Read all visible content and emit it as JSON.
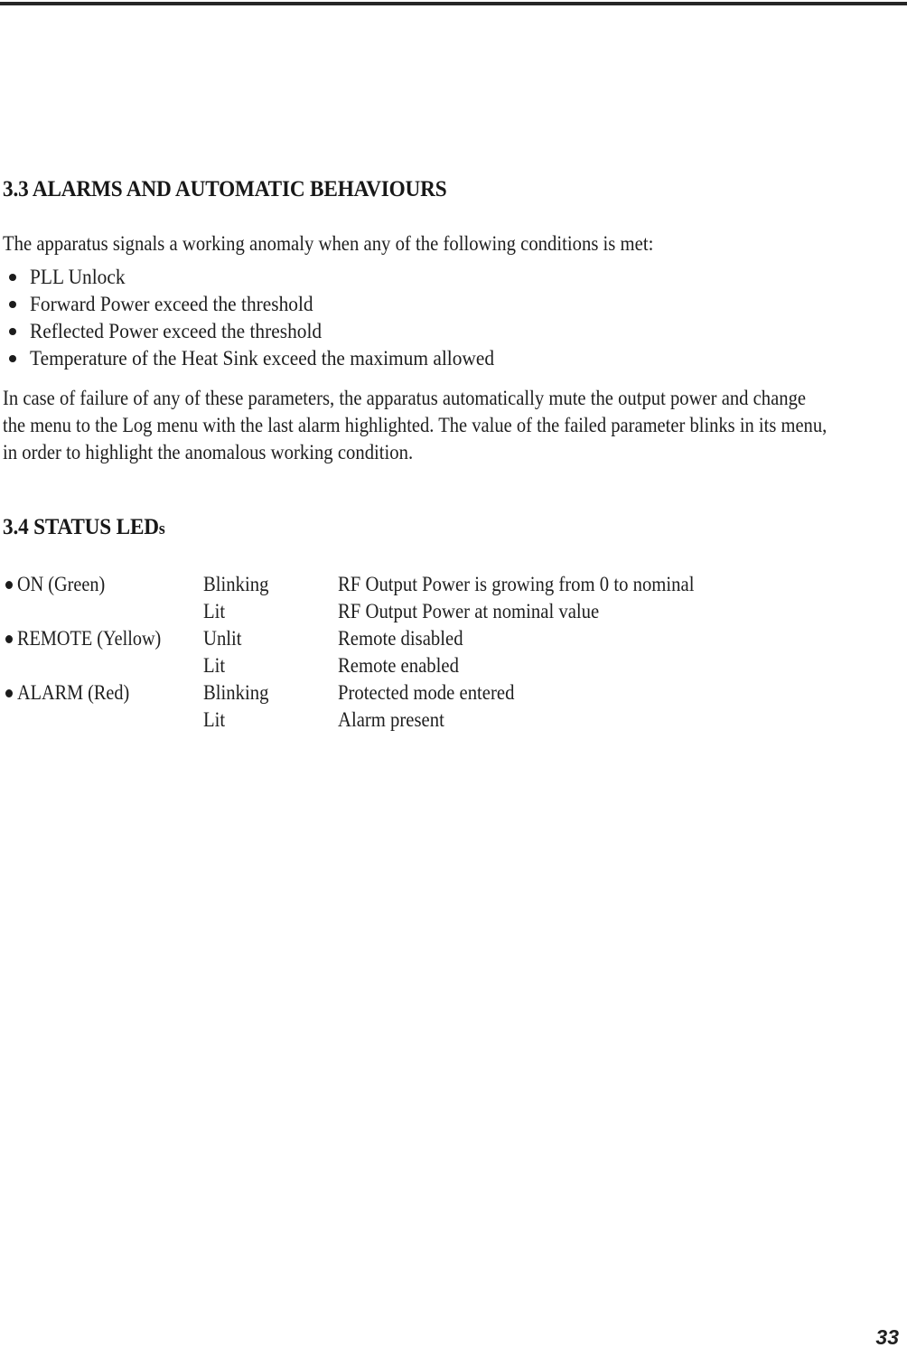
{
  "document": {
    "page_number": "33"
  },
  "sections": [
    {
      "heading": "3.3 ALARMS AND AUTOMATIC BEHAVIOURS",
      "intro": "The apparatus signals a working anomaly when any of the following conditions is met:",
      "bullets": [
        "PLL Unlock",
        "Forward Power exceed the threshold",
        "Reflected Power exceed the threshold",
        "Temperature of the Heat Sink exceed the maximum allowed"
      ],
      "paragraph_lines": [
        "In case of failure of any of these parameters, the apparatus automatically mute the output power and change",
        "the menu to the Log menu with the last alarm highlighted. The value of the failed parameter blinks in its menu,",
        "in order to highlight the anomalous working condition."
      ]
    },
    {
      "heading_main": "3.4 STATUS LED",
      "heading_sub": "s",
      "led_rows": [
        {
          "name": "ON (Green)",
          "state": "Blinking",
          "description": "RF Output Power is growing from 0 to nominal",
          "show_bullet": true
        },
        {
          "name": "",
          "state": "Lit",
          "description": "RF Output Power at nominal value",
          "show_bullet": false
        },
        {
          "name": "REMOTE (Yellow)",
          "state": "Unlit",
          "description": "Remote disabled",
          "show_bullet": true
        },
        {
          "name": "",
          "state": "Lit",
          "description": "Remote enabled",
          "show_bullet": false
        },
        {
          "name": "ALARM (Red)",
          "state": "Blinking",
          "description": "Protected mode entered",
          "show_bullet": true
        },
        {
          "name": "",
          "state": "Lit",
          "description": "Alarm present",
          "show_bullet": false
        }
      ]
    }
  ]
}
